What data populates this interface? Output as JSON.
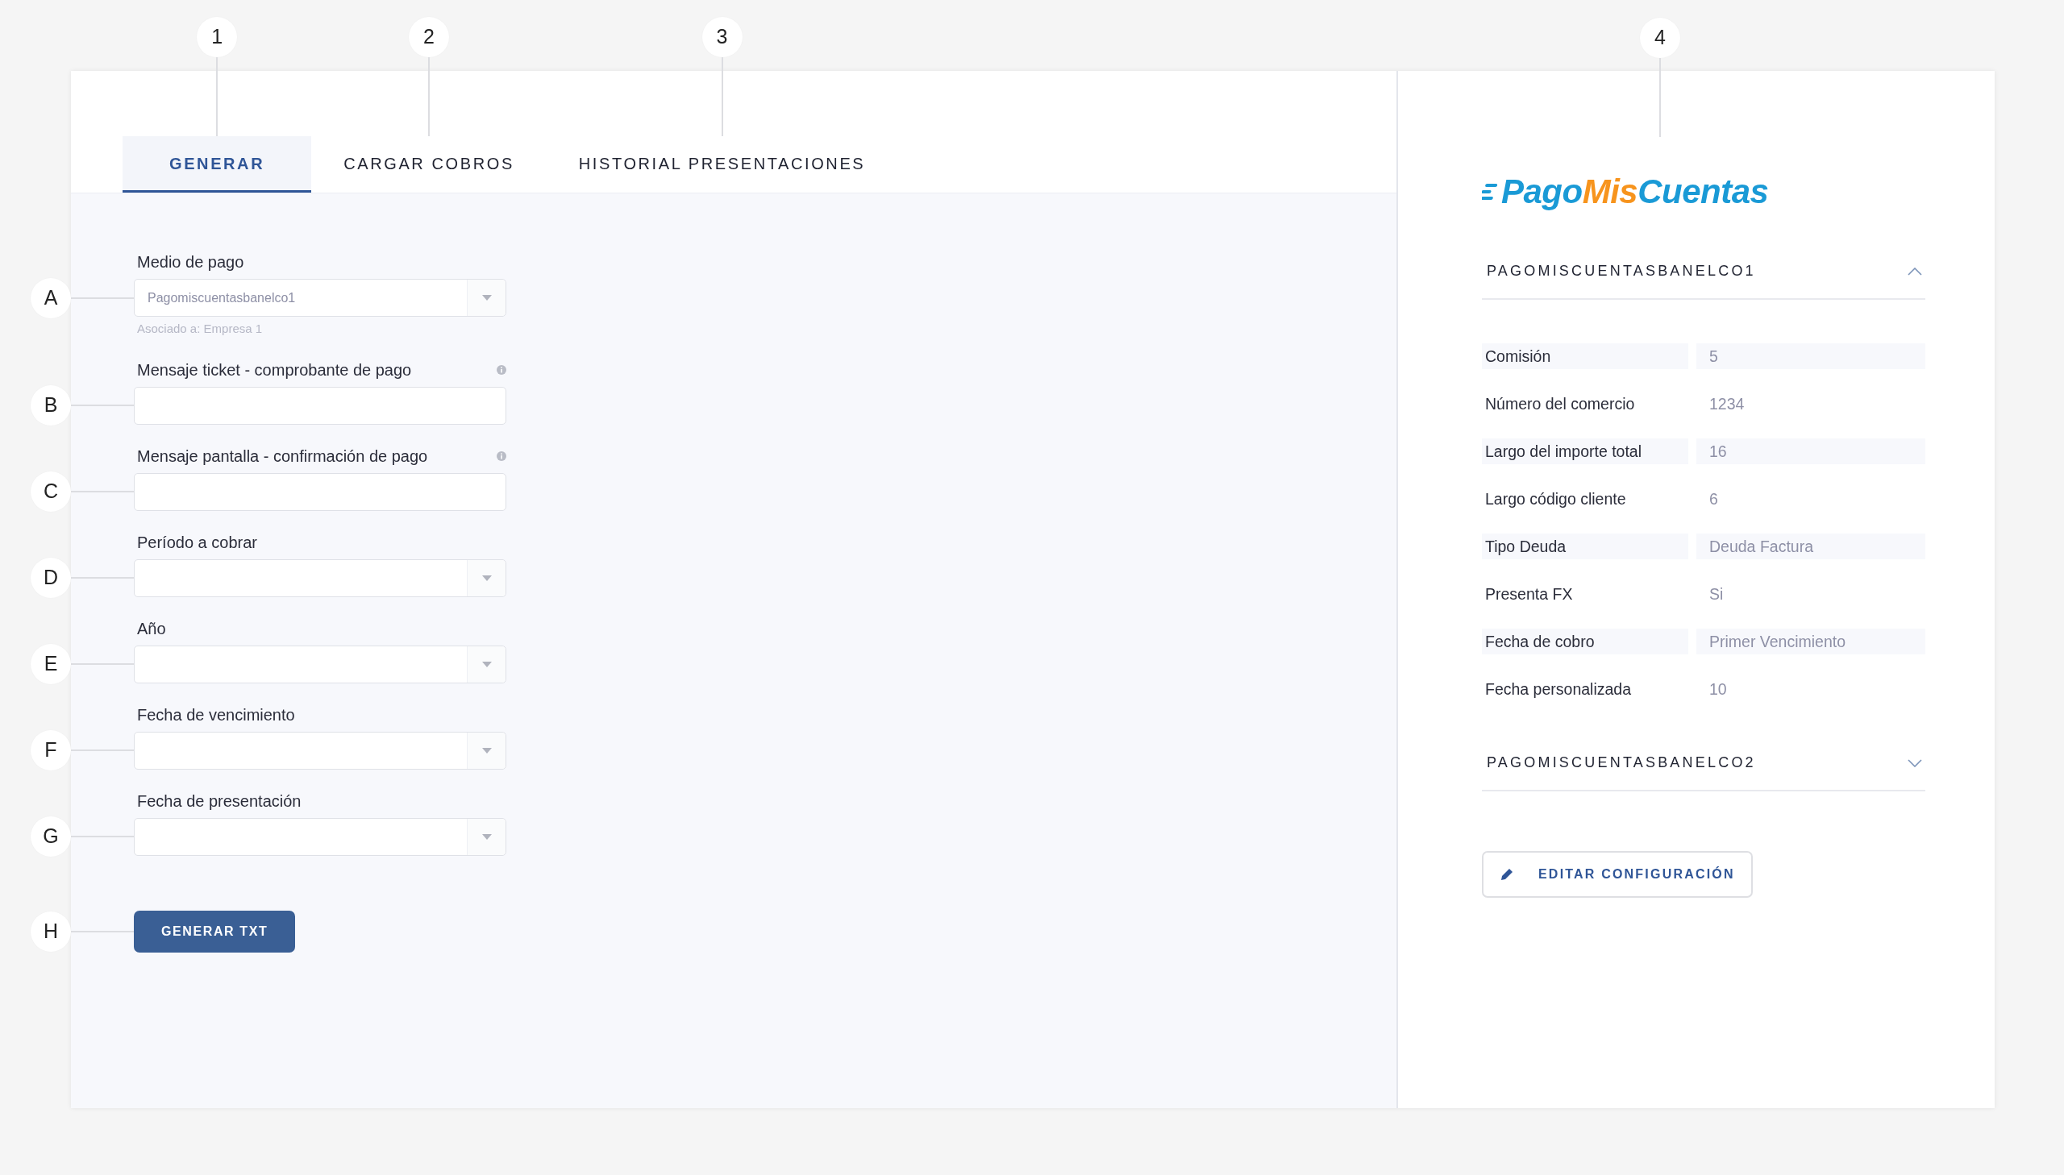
{
  "tabs": [
    {
      "label": "GENERAR",
      "selected": true,
      "callout": "1"
    },
    {
      "label": "CARGAR COBROS",
      "selected": false,
      "callout": "2"
    },
    {
      "label": "HISTORIAL PRESENTACIONES",
      "selected": false,
      "callout": "3"
    }
  ],
  "form": {
    "fields": [
      {
        "callout": "A",
        "label": "Medio de pago",
        "kind": "select",
        "value": "Pagomiscuentasbanelco1",
        "hint": "Asociado a: Empresa 1",
        "info": false
      },
      {
        "callout": "B",
        "label": "Mensaje ticket - comprobante de pago",
        "kind": "text",
        "info": true
      },
      {
        "callout": "C",
        "label": "Mensaje pantalla - confirmación de pago",
        "kind": "text",
        "info": true
      },
      {
        "callout": "D",
        "label": "Período a cobrar",
        "kind": "select",
        "info": false
      },
      {
        "callout": "E",
        "label": "Año",
        "kind": "select",
        "info": false
      },
      {
        "callout": "F",
        "label": "Fecha de vencimiento",
        "kind": "select",
        "info": false
      },
      {
        "callout": "G",
        "label": "Fecha de presentación",
        "kind": "select",
        "info": false
      }
    ],
    "submit": {
      "callout": "H",
      "label": "GENERAR TXT"
    }
  },
  "side_panel": {
    "callout": "4",
    "logo": {
      "parts": [
        {
          "text": "Pago",
          "color": "#1a9ad6"
        },
        {
          "text": "Mis",
          "color": "#f7941d"
        },
        {
          "text": "Cuentas",
          "color": "#1a9ad6"
        }
      ]
    },
    "accounts": [
      {
        "title": "PAGOMISCUENTASBANELCO1",
        "expanded": true,
        "rows": [
          {
            "label": "Comisión",
            "value": "5"
          },
          {
            "label": "Número del comercio",
            "value": "1234"
          },
          {
            "label": "Largo del importe total",
            "value": "16"
          },
          {
            "label": "Largo código cliente",
            "value": "6"
          },
          {
            "label": "Tipo Deuda",
            "value": "Deuda Factura"
          },
          {
            "label": "Presenta FX",
            "value": "Si"
          },
          {
            "label": "Fecha de cobro",
            "value": "Primer Vencimiento"
          },
          {
            "label": "Fecha personalizada",
            "value": "10"
          }
        ]
      },
      {
        "title": "PAGOMISCUENTASBANELCO2",
        "expanded": false
      }
    ],
    "edit_button": "EDITAR CONFIGURACIÓN"
  }
}
